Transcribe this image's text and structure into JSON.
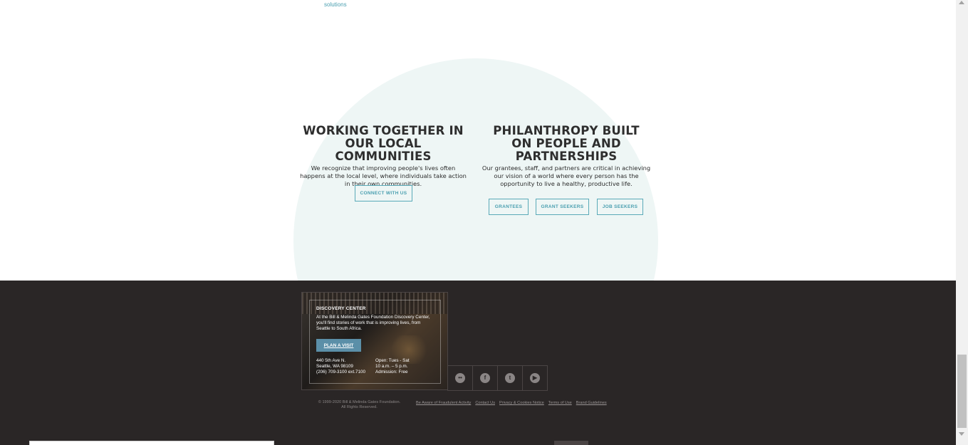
{
  "top_link": {
    "label": "solutions"
  },
  "left_column": {
    "title": "WORKING TOGETHER IN OUR LOCAL COMMUNITIES",
    "body": "We recognize that improving people's lives often happens at the local level, where individuals take action in their own communities.",
    "button": "CONNECT WITH US"
  },
  "right_column": {
    "title": "PHILANTHROPY BUILT ON PEOPLE AND PARTNERSHIPS",
    "body": "Our grantees, staff, and partners are critical in achieving our vision of a world where every person has the opportunity to live a healthy, productive life.",
    "buttons": [
      "GRANTEES",
      "GRANT SEEKERS",
      "JOB SEEKERS"
    ]
  },
  "discovery_center": {
    "title": "DISCOVERY CENTER",
    "description": "At the Bill & Melinda Gates Foundation Discovery Center, you'll find stories of work that is improving lives, from Seattle to South Africa.",
    "button": "PLAN A VISIT",
    "address": [
      "440 5th Ave N.",
      "Seattle, WA 98109",
      "(206) 709-3100 ext.7100"
    ],
    "hours": [
      "Open: Tues - Sat",
      "10 a.m. – 5 p.m.",
      "Admission: Free"
    ]
  },
  "social": [
    {
      "icon": "flickr-icon",
      "glyph": "••"
    },
    {
      "icon": "facebook-icon",
      "glyph": "f"
    },
    {
      "icon": "twitter-icon",
      "glyph": "t"
    },
    {
      "icon": "youtube-icon",
      "glyph": "▶"
    }
  ],
  "footer": {
    "copyright_line1": "© 1999-2020 Bill & Melinda Gates Foundation.",
    "copyright_line2": "All Rights Reserved.",
    "links": [
      "Be Aware of Fraudulent Activity",
      "Contact Us",
      "Privacy & Cookies Notice",
      "Terms of Use",
      "Brand Guidelines"
    ]
  },
  "colors": {
    "accent": "#4a9fb0",
    "circle_bg": "#eef6f5",
    "footer_bg": "#2a2626",
    "plan_button": "#5b8fa8"
  }
}
